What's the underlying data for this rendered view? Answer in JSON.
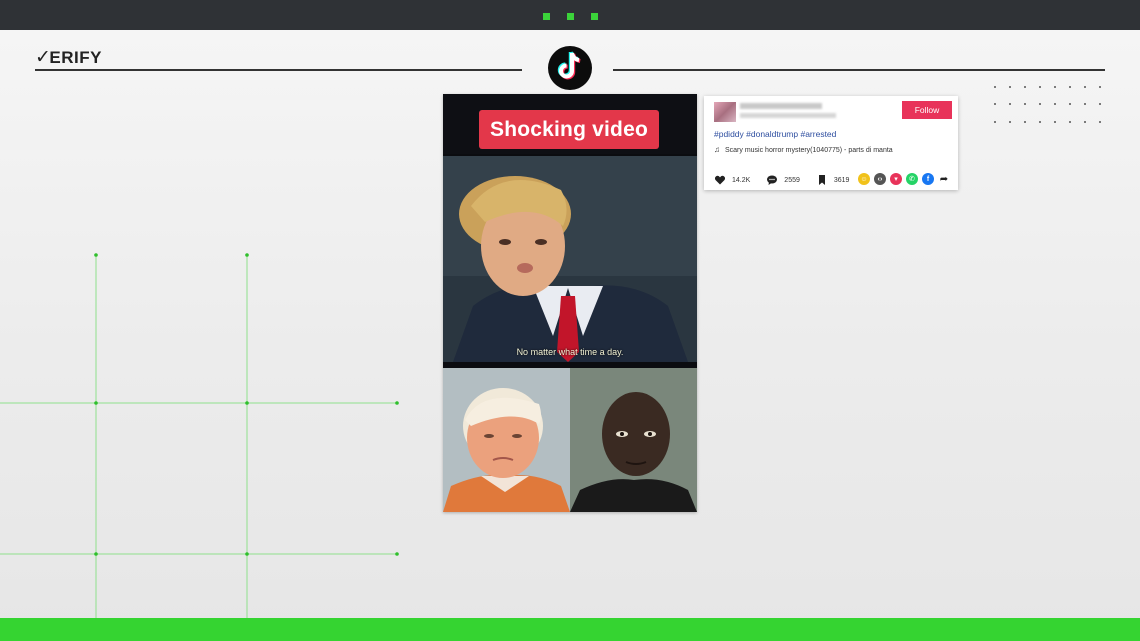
{
  "brand": {
    "logo_text": "ERIFY",
    "check_mark": "✓"
  },
  "video": {
    "badge_text": "Shocking video",
    "caption": "No matter what time a day."
  },
  "post": {
    "follow_label": "Follow",
    "hashtags": "#pdiddy #donaldtrump #arrested",
    "music": "Scary music horror mystery(1040775) - parts di manta",
    "likes": "14.2K",
    "comments": "2559",
    "saves": "3619",
    "share_icons": [
      "embed-icon",
      "code-icon",
      "send-icon",
      "whatsapp-icon",
      "facebook-icon",
      "share-arrow-icon"
    ]
  },
  "colors": {
    "accent_green": "#35d431",
    "tiktok_red": "#e8335a",
    "badge_red": "#e3374a",
    "hashtag_blue": "#2f4fa0"
  }
}
